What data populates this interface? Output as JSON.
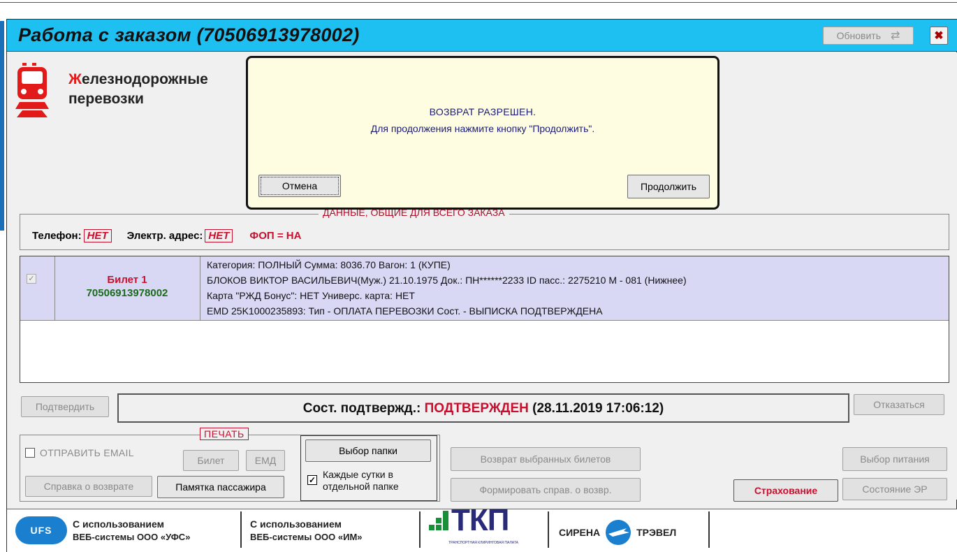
{
  "window": {
    "title": "Работа с заказом (70506913978002)",
    "refresh_label": "Обновить"
  },
  "logo": {
    "line1_first": "Ж",
    "line1_rest": "елезнодорожные",
    "line2": "перевозки"
  },
  "dialog": {
    "line1": "ВОЗВРАТ РАЗРЕШЕН.",
    "line2": "Для продолжения нажмите кнопку \"Продолжить\".",
    "cancel_label": "Отмена",
    "continue_label": "Продолжить"
  },
  "order_common": {
    "legend": "ДАННЫЕ, ОБЩИЕ ДЛЯ ВСЕГО ЗАКАЗА",
    "phone_label": "Телефон:",
    "phone_value": "НЕТ",
    "email_label": "Электр. адрес:",
    "email_value": "НЕТ",
    "fop": "ФОП = НА"
  },
  "ticket": {
    "name": "Билет 1",
    "number": "70506913978002",
    "line1": "Категория: ПОЛНЫЙ  Сумма: 8036.70  Вагон: 1 (КУПЕ)",
    "line2": "БЛОКОВ ВИКТОР ВАСИЛЬЕВИЧ(Муж.) 21.10.1975  Док.: ПН******2233  ID пасс.: 2275210  М - 081 (Нижнее)",
    "line3": "Карта \"РЖД Бонус\": НЕТ  Универс. карта: НЕТ",
    "line4": "EMD 25K1000235893: Тип - ОПЛАТА ПЕРЕВОЗКИ Сост. - ВЫПИСКА ПОДТВЕРЖДЕНА"
  },
  "status": {
    "confirm_label": "Подтвердить",
    "label": "Сост. подтвержд.:",
    "value": "ПОДТВЕРЖДЕН",
    "datetime": "(28.11.2019 17:06:12)",
    "refuse_label": "Отказаться"
  },
  "print": {
    "legend": "ПЕЧАТЬ",
    "send_email": "ОТПРАВИТЬ EMAIL",
    "ticket_btn": "Билет",
    "emd_btn": "ЕМД",
    "refund_cert_btn": "Справка о возврате",
    "memo_btn": "Памятка пассажира",
    "folder_btn": "Выбор папки",
    "daily_folder_line1": "Каждые сутки в",
    "daily_folder_line2": "отдельной папке"
  },
  "actions": {
    "return_selected": "Возврат выбранных билетов",
    "form_refund_cert": "Формировать справ. о возвр.",
    "insurance": "Страхование",
    "meal_choice": "Выбор питания",
    "er_state": "Состояние ЭР"
  },
  "footer": {
    "ufs_logo": "UFS",
    "ufs_line1": "С использованием",
    "ufs_line2": "ВЕБ-системы ООО «УФС»",
    "im_line1": "С использованием",
    "im_line2": "ВЕБ-системы ООО «ИМ»",
    "tkp_logo": "ТКП",
    "tkp_caption": "ТРАНСПОРТНАЯ КЛИРИНГОВАЯ ПАЛАТА",
    "sirena_left": "СИРЕНА",
    "sirena_right": "ТРЭВЕЛ"
  },
  "colors": {
    "titlebar": "#1ec0f2",
    "dialog_bg": "#fefde2",
    "ticket_row": "#d8d8f5",
    "accent_red": "#c8102e",
    "ticket_green": "#1a6b1a"
  }
}
